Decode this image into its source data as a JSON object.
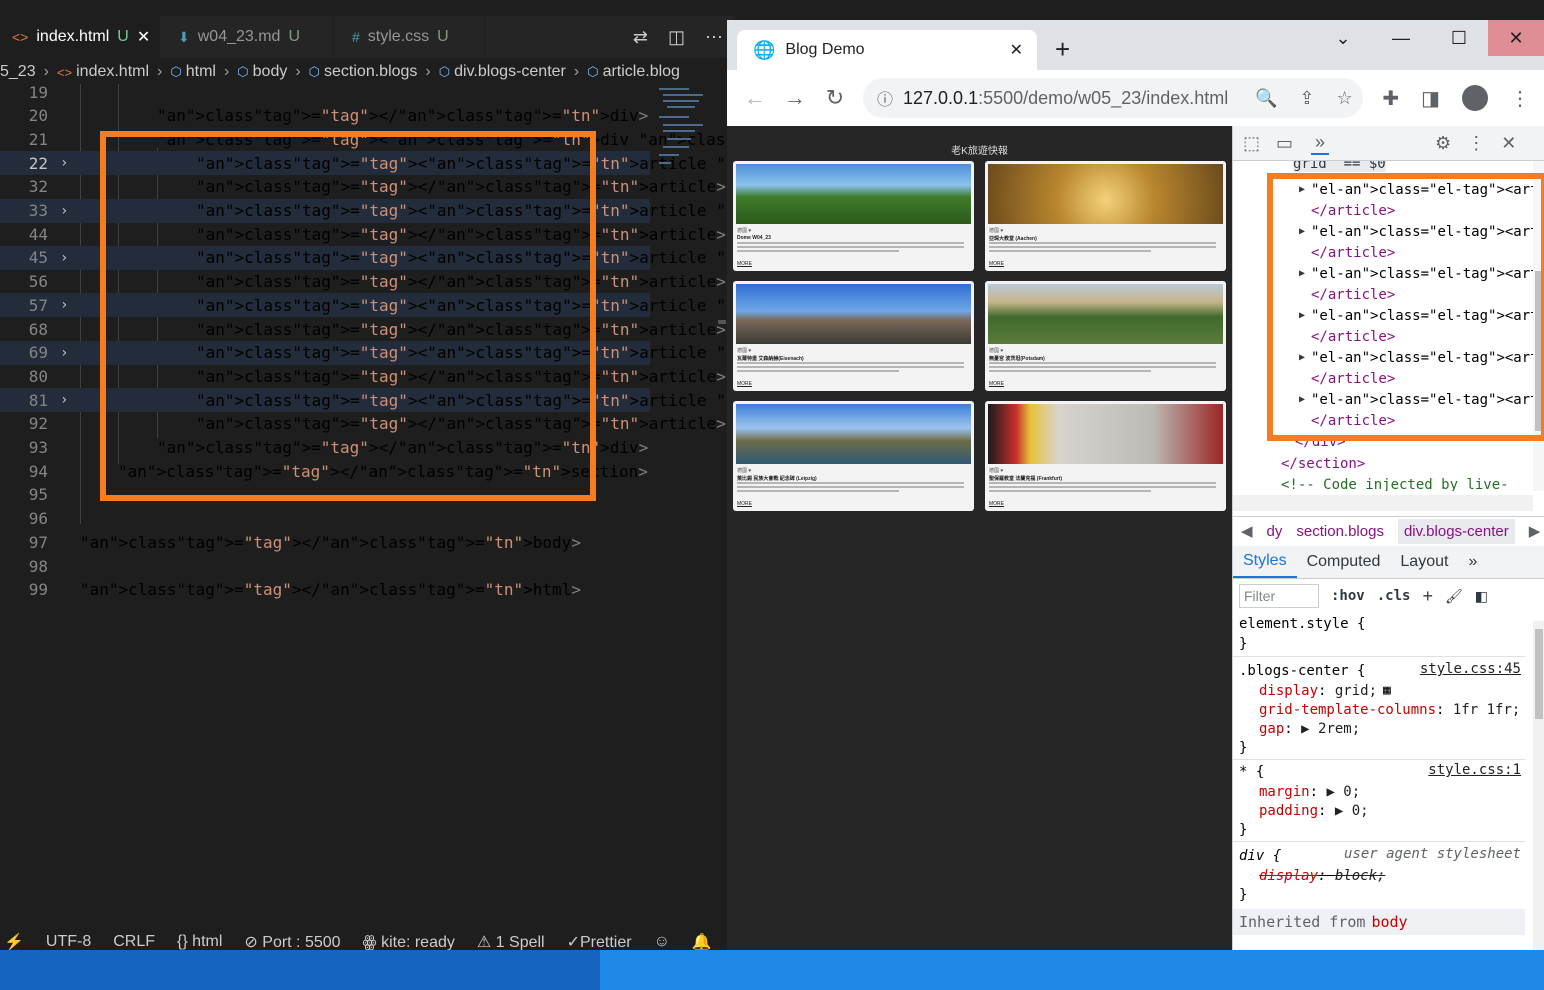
{
  "vscode": {
    "tabs": [
      {
        "name": "index.html",
        "status": "U",
        "icon": "html-file-icon",
        "active": true,
        "close": "✕"
      },
      {
        "name": "w04_23.md",
        "status": "U",
        "icon": "markdown-file-icon",
        "active": false
      },
      {
        "name": "style.css",
        "status": "U",
        "icon": "css-file-icon",
        "active": false
      }
    ],
    "breadcrumb": [
      "5_23",
      "index.html",
      "html",
      "body",
      "section.blogs",
      "div.blogs-center",
      "article.blog"
    ],
    "lines": [
      {
        "n": "19",
        "text": ""
      },
      {
        "n": "20",
        "text": "</div>"
      },
      {
        "n": "21",
        "text": "<div class=\"blogs-center\">"
      },
      {
        "n": "22",
        "text": "<article class=\"blog\">…"
      },
      {
        "n": "32",
        "text": "</article>"
      },
      {
        "n": "33",
        "text": "<article class=\"blog\">…"
      },
      {
        "n": "44",
        "text": "</article>"
      },
      {
        "n": "45",
        "text": "<article class=\"blog\">…"
      },
      {
        "n": "56",
        "text": "</article>"
      },
      {
        "n": "57",
        "text": "<article class=\"blog\">…"
      },
      {
        "n": "68",
        "text": "</article>"
      },
      {
        "n": "69",
        "text": "<article class=\"blog\">…"
      },
      {
        "n": "80",
        "text": "</article>"
      },
      {
        "n": "81",
        "text": "<article class=\"blog\">…"
      },
      {
        "n": "92",
        "text": "</article>"
      },
      {
        "n": "93",
        "text": "</div>"
      },
      {
        "n": "94",
        "text": "</section>"
      },
      {
        "n": "95",
        "text": ""
      },
      {
        "n": "96",
        "text": ""
      },
      {
        "n": "97",
        "text": "</body>"
      },
      {
        "n": "98",
        "text": ""
      },
      {
        "n": "99",
        "text": "</html>"
      }
    ],
    "status": {
      "encoding": "UTF-8",
      "eol": "CRLF",
      "language": "html",
      "port": "Port : 5500",
      "kite": "kite: ready",
      "spell": "1 Spell",
      "prettier": "Prettier"
    },
    "highlight_color": "#f57c1f"
  },
  "chrome": {
    "tab_title": "Blog Demo",
    "url_host": "127.0.0.1",
    "url_path": ":5500/demo/w05_23/index.html",
    "page": {
      "heading": "老K旅遊快報",
      "blogs": [
        {
          "tag": "德國 ♥",
          "title": "Dome W04_23",
          "more": "MORE"
        },
        {
          "tag": "德國 ♥",
          "title": "亞琛大教堂 (Aachen)",
          "more": "MORE"
        },
        {
          "tag": "德國 ♥",
          "title": "瓦爾特堡 艾森納赫(Eisenach)",
          "more": "MORE"
        },
        {
          "tag": "德國 ♥",
          "title": "無憂宮 波茨坦(Potsdam)",
          "more": "MORE"
        },
        {
          "tag": "德國 ♥",
          "title": "萊比錫 民族大會戰 紀念碑 (Leipzig)",
          "more": "MORE"
        },
        {
          "tag": "德國 ♥",
          "title": "聖保羅教堂 法蘭克福 (Frankfurt)",
          "more": "MORE"
        }
      ]
    }
  },
  "devtools": {
    "elements": {
      "top_partial": "grid  == $0",
      "articles": [
        {
          "open": "<article class=\"blog\">",
          "close": "</article>"
        },
        {
          "open": "<article class=\"blog\">",
          "close": "</article>"
        },
        {
          "open": "<article class=\"blog\">",
          "close": "</article>"
        },
        {
          "open": "<article class=\"blog\">",
          "close": "</article>"
        },
        {
          "open": "<article class=\"blog\">",
          "close": "</article>"
        },
        {
          "open": "<article class=\"blog\">",
          "close": "</article>"
        }
      ],
      "div_close": "</div>",
      "section_close": "</section>",
      "comment": "<!-- Code injected by live-"
    },
    "crumbs": [
      "dy",
      "section.blogs",
      "div.blogs-center"
    ],
    "subtabs": [
      "Styles",
      "Computed",
      "Layout"
    ],
    "filter_placeholder": "Filter",
    "hov": ":hov",
    "cls": ".cls",
    "styles": {
      "element_style": "element.style {",
      "rule1": {
        "selector": ".blogs-center {",
        "source": "style.css:45",
        "decls": [
          {
            "prop": "display",
            "val": "grid;"
          },
          {
            "prop": "grid-template-columns",
            "val": "1fr 1fr;"
          },
          {
            "prop": "gap",
            "val": "▶ 2rem;"
          }
        ]
      },
      "rule2": {
        "selector": "* {",
        "source": "style.css:1",
        "decls": [
          {
            "prop": "margin",
            "val": "▶ 0;"
          },
          {
            "prop": "padding",
            "val": "▶ 0;"
          }
        ]
      },
      "rule3": {
        "selector": "div {",
        "source": "user agent stylesheet",
        "decls": [
          {
            "prop": "display",
            "val": "block;"
          }
        ]
      },
      "close": "}",
      "inherited_label": "Inherited from",
      "inherited_el": "body"
    }
  }
}
